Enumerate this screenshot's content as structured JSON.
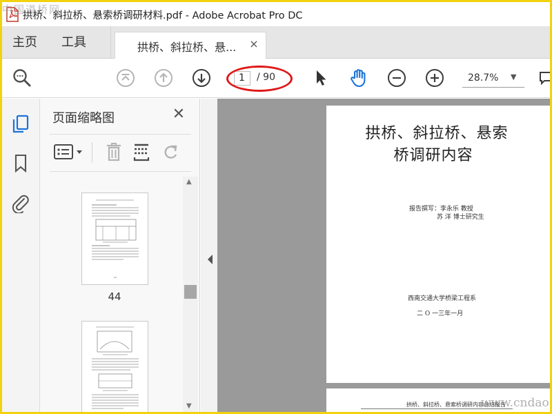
{
  "window": {
    "title": "拱桥、斜拉桥、悬索桥调研材料.pdf - Adobe Acrobat Pro DC",
    "watermark_top": "中国道桥网",
    "watermark_bottom": "www.cndao.com"
  },
  "tabs": {
    "home": "主页",
    "tools": "工具",
    "document": "拱桥、斜拉桥、悬...",
    "close": "×"
  },
  "toolbar": {
    "current_page": "1",
    "total_pages": "/ 90",
    "zoom": "28.7%"
  },
  "panel": {
    "title": "页面缩略图",
    "thumb_label": "44"
  },
  "document": {
    "title_line1": "拱桥、斜拉桥、悬索",
    "title_line2": "桥调研内容",
    "author_line1": "报告撰写：李永乐  教授",
    "author_line2": "苏  洋  博士研究生",
    "department": "西南交通大学桥梁工程系",
    "date": "二 O 一三年一月",
    "next_page_footer": "拱桥、斜拉桥、悬索桥调研内容总结报告"
  },
  "colors": {
    "brand_blue": "#1a73d9",
    "annotation_red": "#e01818",
    "frame_yellow": "#f2d20e"
  }
}
